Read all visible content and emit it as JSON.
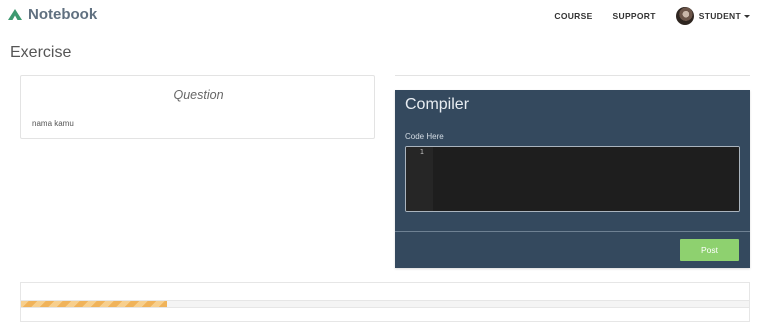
{
  "app": {
    "brand": "Notebook",
    "brand_color": "#3d9970",
    "nav": {
      "course": "COURSE",
      "support": "SUPPORT",
      "student": "STUDENT"
    }
  },
  "page": {
    "title": "Exercise"
  },
  "question": {
    "title": "Question",
    "text": "nama kamu"
  },
  "compiler": {
    "title": "Compiler",
    "code_label": "Code Here",
    "line_numbers": [
      "1"
    ],
    "code": "",
    "post_label": "Post",
    "post_color": "#8ed16f",
    "panel_color": "#34495e"
  },
  "progress": {
    "percent": 20
  }
}
